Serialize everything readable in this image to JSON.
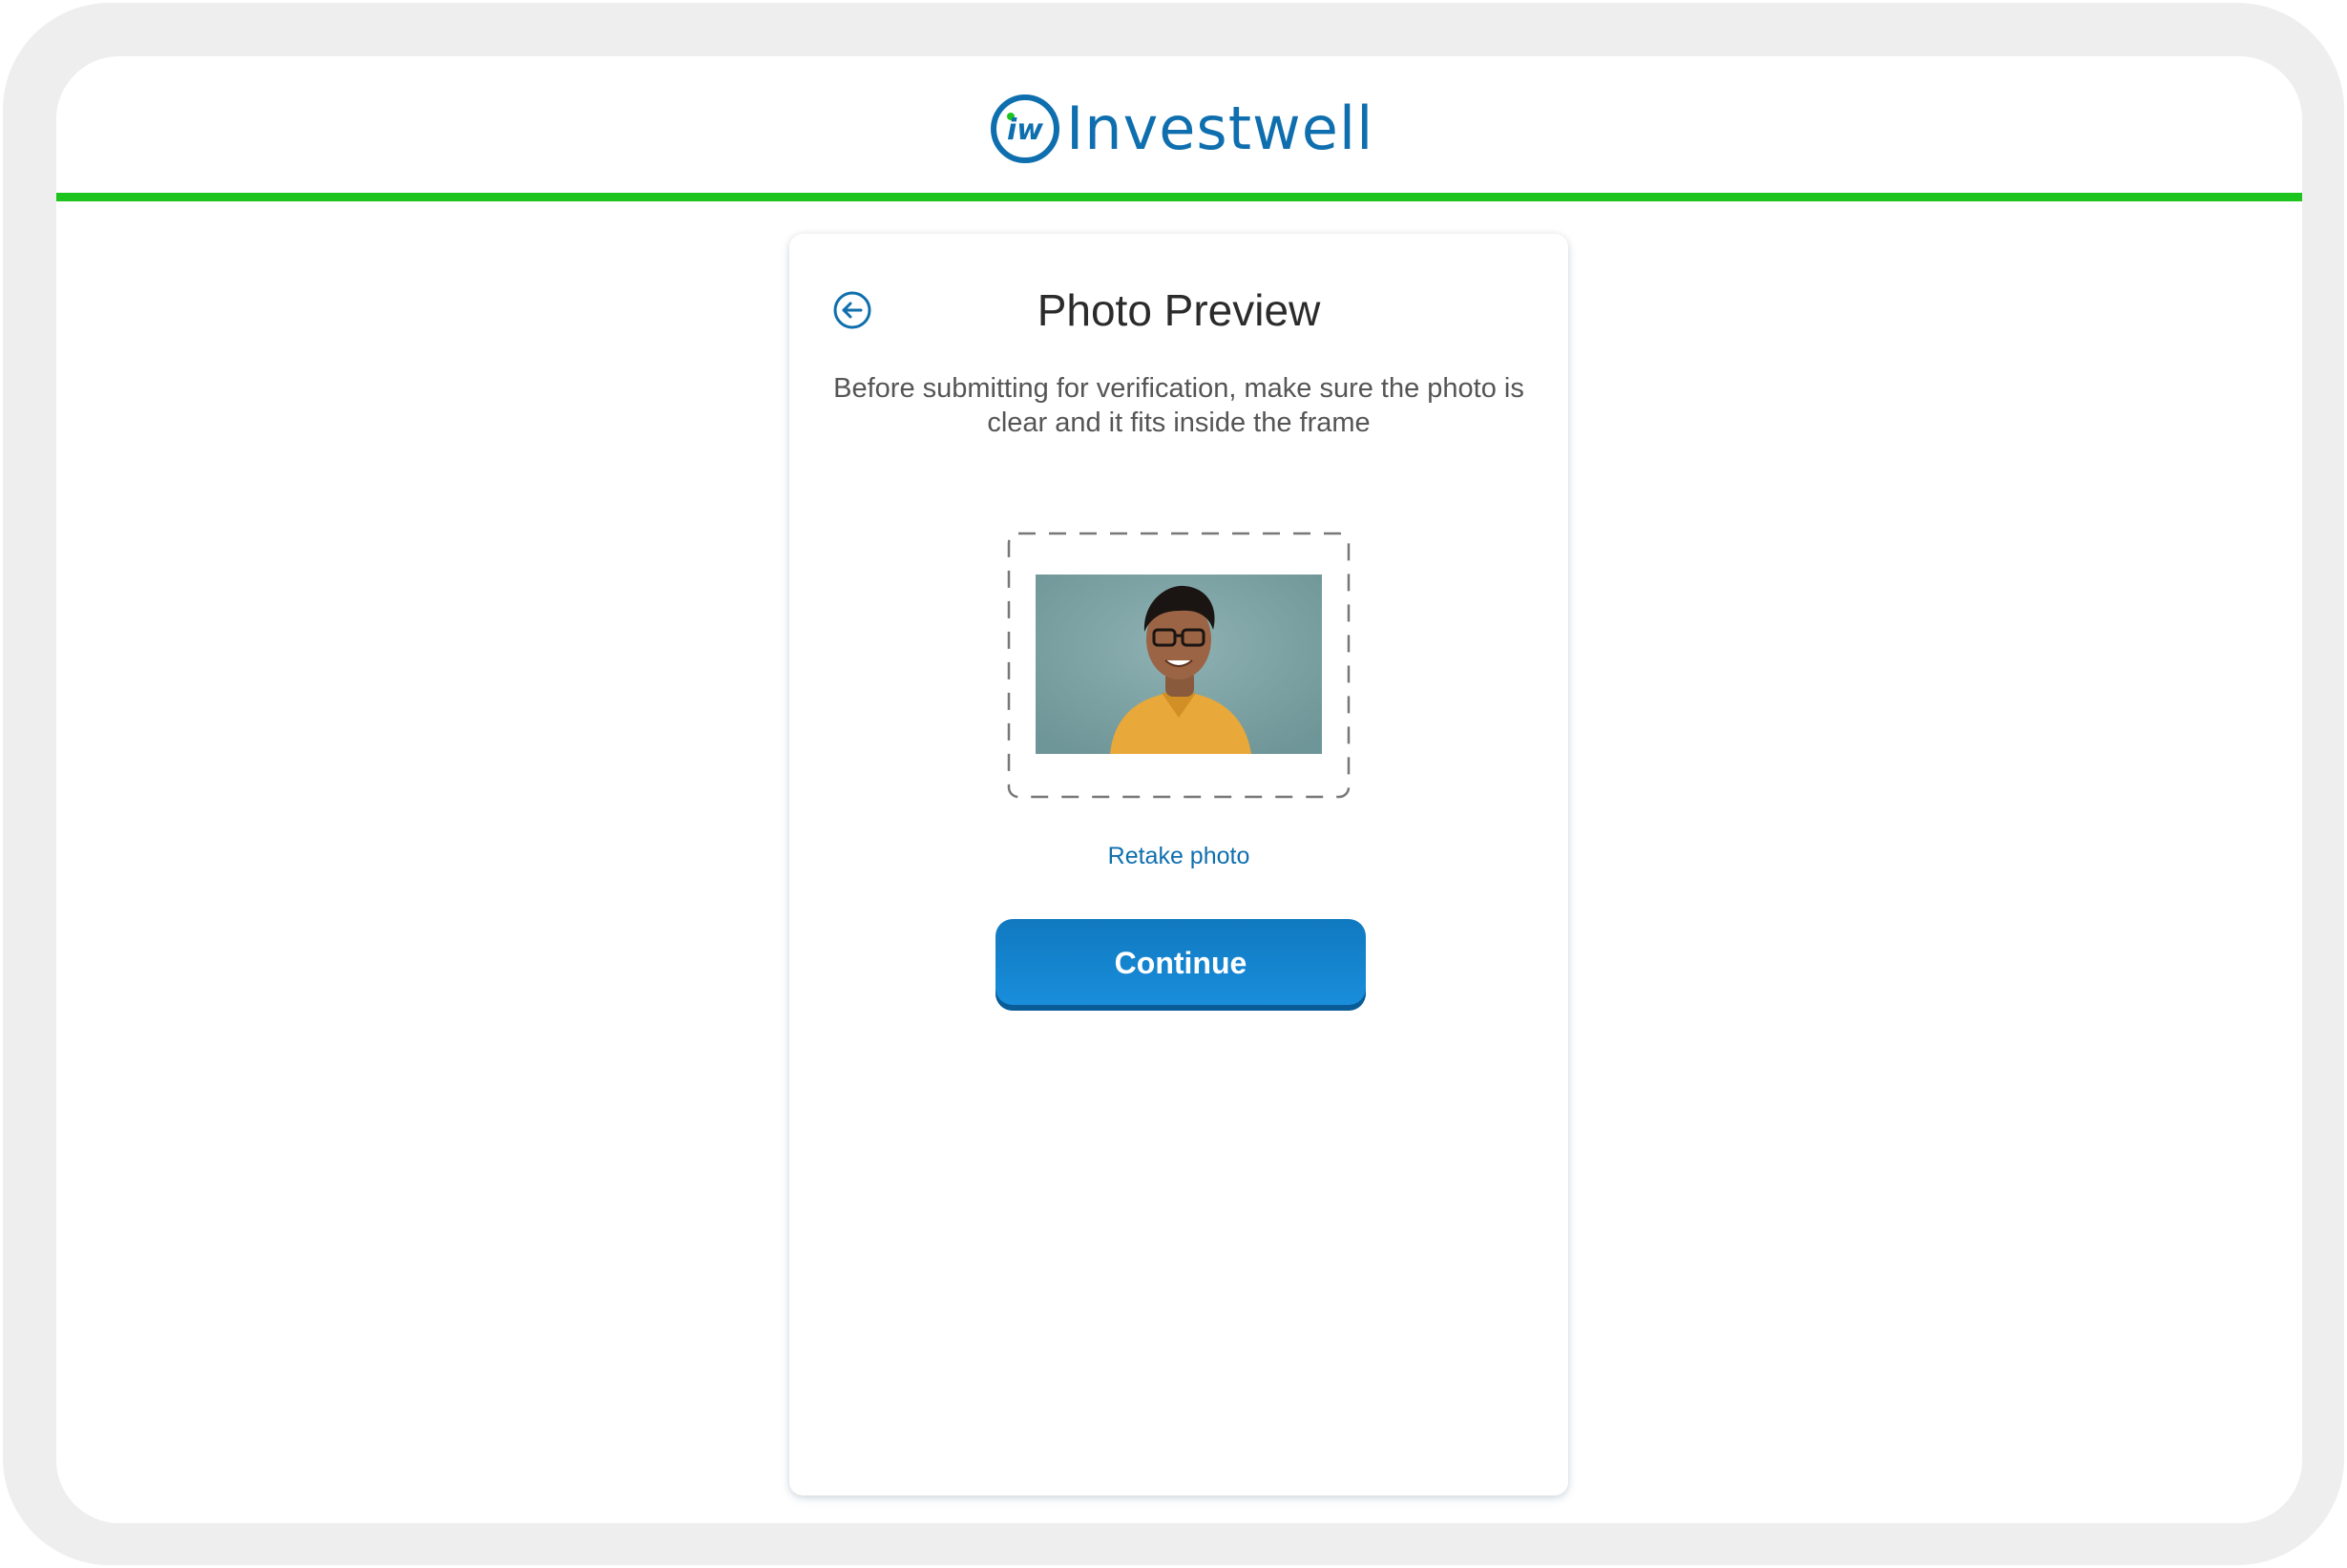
{
  "header": {
    "brand_name": "Investwell",
    "brand_logo_text": "iw",
    "logo_icon": "investwell-logo-icon",
    "accent_line_color": "#1ec41e"
  },
  "card": {
    "back_icon": "arrow-left-circle-icon",
    "title": "Photo Preview",
    "description": "Before submitting for verification, make sure the photo is clear and it fits inside the frame",
    "photo_alt": "photo preview",
    "retake_label": "Retake photo",
    "continue_label": "Continue"
  },
  "colors": {
    "brand_blue": "#0f6fae",
    "button_blue": "#1a8fdd",
    "title_text": "#2b2b2b",
    "body_text": "#555555"
  }
}
